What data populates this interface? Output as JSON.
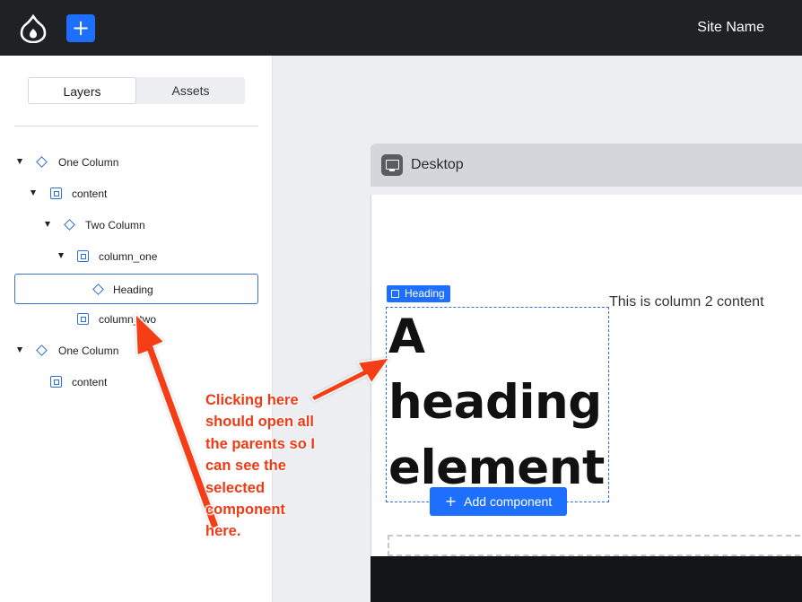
{
  "topbar": {
    "logo_icon": "drupal-drop-icon",
    "add_button_label": "+",
    "site_name": "Site Name"
  },
  "sidebar": {
    "tabs": [
      {
        "label": "Layers",
        "active": true
      },
      {
        "label": "Assets",
        "active": false
      }
    ],
    "tree": [
      {
        "label": "One Column",
        "icon": "diamond-icon",
        "expanded": true
      },
      {
        "label": "content",
        "icon": "region-icon",
        "expanded": true
      },
      {
        "label": "Two Column",
        "icon": "diamond-icon",
        "expanded": true
      },
      {
        "label": "column_one",
        "icon": "region-icon",
        "expanded": true
      },
      {
        "label": "Heading",
        "icon": "diamond-icon",
        "selected": true
      },
      {
        "label": "column_two",
        "icon": "region-icon"
      },
      {
        "label": "One Column",
        "icon": "diamond-icon",
        "expanded": true
      },
      {
        "label": "content",
        "icon": "region-icon"
      }
    ]
  },
  "canvas": {
    "viewport_label": "Desktop",
    "viewport_icon": "monitor-icon",
    "heading_tag": "Heading",
    "heading_text": "A heading element",
    "column_two_text": "This is column 2 content",
    "add_component_label": "Add component"
  },
  "annotation": {
    "text": "Clicking here\nshould open all\nthe parents so I\ncan see the\nselected\ncomponent\n here.",
    "color": "#f03a16"
  },
  "colors": {
    "accent": "#1f6fff",
    "topbar": "#1f2125",
    "tree_icon": "#2f6fd8"
  }
}
